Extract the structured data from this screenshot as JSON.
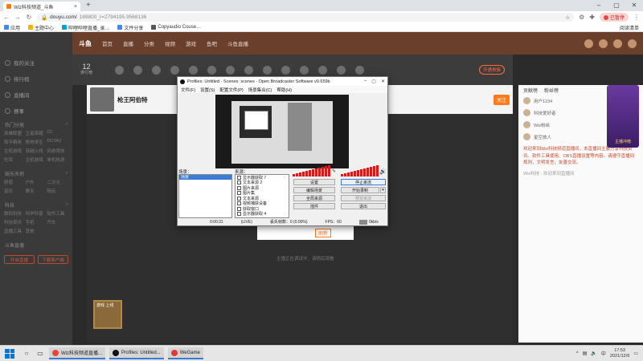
{
  "browser": {
    "tab_title": "Wiz科技频道_斗鱼",
    "url_domain": "douyu.com/",
    "url_path": "169800_r=2794195.9568136",
    "paused_label": "已暂停"
  },
  "bookmarks": [
    {
      "label": "应用",
      "color": "#4285f4"
    },
    {
      "label": "主题中心",
      "color": "#f4b400"
    },
    {
      "label": "哔哩哔哩直播_录…",
      "color": "#00a1d6"
    },
    {
      "label": "文件分享",
      "color": "#4285f4"
    },
    {
      "label": "Copyaudio Couse…",
      "color": "#555555"
    }
  ],
  "bookmarks_other": "阅读清单",
  "site": {
    "logo": "斗鱼",
    "nav": [
      "首页",
      "直播",
      "分类",
      "视频",
      "游戏",
      "鱼吧",
      "斗鱼直播"
    ]
  },
  "sidebar": {
    "items": [
      "我的关注",
      "排行榜",
      "直播间",
      "赛事"
    ],
    "sec1": "热门分类",
    "grid1": [
      "英雄联盟",
      "王者荣耀",
      "CF",
      "和平精英",
      "绝地求生",
      "DOTA2",
      "主机游戏",
      "穿越火线",
      "网游竞技",
      "吃鸡",
      "主机游戏",
      "单机热游"
    ],
    "sec2": "娱乐天地",
    "grid2": [
      "颜值",
      "户外",
      "二次元",
      "音乐",
      "聊天",
      "陪玩"
    ],
    "sec3": "科技",
    "grid3": [
      "数码科技",
      "科学科普",
      "软件工具",
      "科技资讯",
      "手机",
      "汽车",
      "直播工具",
      "其他"
    ],
    "sec4": "斗鱼直播",
    "btns": [
      "开启直播",
      "下载客户端"
    ]
  },
  "room": {
    "rank": "12",
    "rank_label": "排行榜",
    "pay_button": "开通贵族",
    "streamer_name": "枪王阿伯特",
    "follow_button": "关注"
  },
  "player": {
    "restart_link": "刷新",
    "hint": "主播正在调试中，请稍后观看",
    "game_label": "游戏 上线"
  },
  "right_panel": {
    "tabs": [
      "贡献榜",
      "粉丝榜"
    ],
    "rows": [
      "用户1234",
      "科技爱好者",
      "Wiz粉丝",
      "星空旅人"
    ],
    "notice": "欢迎来到Wiz科技频道直播间，本直播间主要分享科技资讯、软件工具使用、OBS直播设置等内容。请遵守直播间规则，文明发言，友善交流。",
    "footer": "Wiz科技 · 欢迎来到直播间",
    "gift_label": "主播冲榜"
  },
  "obs": {
    "title": "Profiles: Untitled - Scenes: scenes - Open Broadcaster Software v0.659b",
    "menu": [
      "文件(F)",
      "设置(S)",
      "配置文件(P)",
      "场景集合(C)",
      "帮助(H)"
    ],
    "scenes_label": "场景：",
    "scenes": [
      "场景"
    ],
    "sources_label": "来源：",
    "sources": [
      "显示器获取 7",
      "文本来源 2",
      "图片来源",
      "图片集",
      "文本来源",
      "视频捕获设备",
      "获取窗口",
      "显示器获取 4"
    ],
    "buttons": {
      "settings": "设置",
      "stop_stream": "停止串流",
      "edit_scene": "编辑场景",
      "start_recording": "开始录制",
      "global_sources": "全局来源",
      "preview": "预览串流",
      "plugins": "插件",
      "exit": "退出"
    },
    "status": {
      "time": "0:00:31",
      "code": "(LIVE)",
      "dropped": "丢失帧数：0 (0.00%)",
      "fps": "FPS：60",
      "bitrate": "0kb/s"
    }
  },
  "taskbar": {
    "tasks": [
      {
        "label": "Wiz科技频道直播...",
        "color": "#e8453c"
      },
      {
        "label": "Profiles: Untitled...",
        "color": "#111111"
      },
      {
        "label": "WeGame",
        "color": "#e53935"
      }
    ],
    "time": "17:53",
    "date": "2021/12/9"
  }
}
